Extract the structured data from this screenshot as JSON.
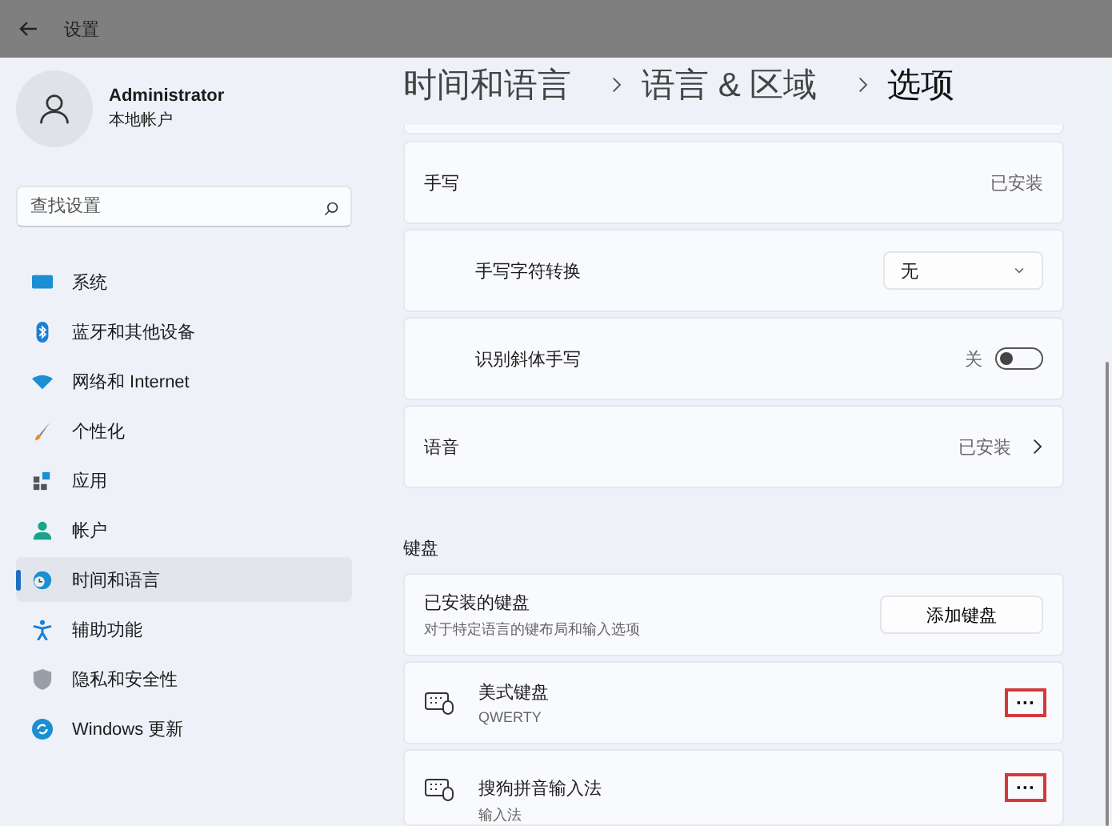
{
  "window": {
    "title": "设置"
  },
  "account": {
    "name": "Administrator",
    "type": "本地帐户"
  },
  "search": {
    "placeholder": "查找设置"
  },
  "sidebar": {
    "items": [
      {
        "label": "系统",
        "selected": false
      },
      {
        "label": "蓝牙和其他设备",
        "selected": false
      },
      {
        "label": "网络和 Internet",
        "selected": false
      },
      {
        "label": "个性化",
        "selected": false
      },
      {
        "label": "应用",
        "selected": false
      },
      {
        "label": "帐户",
        "selected": false
      },
      {
        "label": "时间和语言",
        "selected": true
      },
      {
        "label": "辅助功能",
        "selected": false
      },
      {
        "label": "隐私和安全性",
        "selected": false
      },
      {
        "label": "Windows 更新",
        "selected": false
      }
    ]
  },
  "breadcrumb": [
    "时间和语言",
    "语言 & 区域",
    "选项"
  ],
  "settings": [
    {
      "kind": "info",
      "label": "手写",
      "value": "已安装",
      "indented": false
    },
    {
      "kind": "dropdown",
      "label": "手写字符转换",
      "value": "无",
      "indented": true
    },
    {
      "kind": "toggle",
      "label": "识别斜体手写",
      "value": "关",
      "on": false,
      "indented": true
    },
    {
      "kind": "link",
      "label": "语音",
      "value": "已安装",
      "indented": false
    }
  ],
  "keyboard": {
    "heading": "键盘",
    "installed": {
      "title": "已安装的键盘",
      "subtitle": "对于特定语言的键布局和输入选项",
      "button": "添加键盘"
    },
    "layouts": [
      {
        "name": "美式键盘",
        "detail": "QWERTY",
        "more": "···",
        "highlighted": true
      },
      {
        "name": "搜狗拼音输入法",
        "detail": "输入法",
        "more": "···",
        "highlighted": true
      }
    ]
  }
}
